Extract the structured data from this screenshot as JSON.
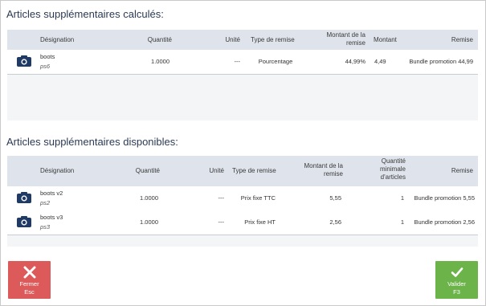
{
  "calc": {
    "title": "Articles supplémentaires calculés:",
    "headers": {
      "designation": "Désignation",
      "quantite": "Quantité",
      "unite": "Unité",
      "type": "Type de remise",
      "montant_remise_1": "Montant de la",
      "montant_remise_2": "remise",
      "montant": "Montant",
      "remise": "Remise"
    },
    "rows": [
      {
        "icon": "camera-icon",
        "name": "boots",
        "code": "ps6",
        "quantite": "1.0000",
        "unite": "---",
        "type": "Pourcentage",
        "montant_remise": "44,99%",
        "montant": "4,49",
        "remise": "Bundle promotion 44,99"
      }
    ]
  },
  "avail": {
    "title": "Articles supplémentaires disponibles:",
    "headers": {
      "designation": "Désignation",
      "quantite": "Quantité",
      "unite": "Unité",
      "type": "Type de remise",
      "montant_remise_1": "Montant de la",
      "montant_remise_2": "remise",
      "qte_min_1": "Quantité",
      "qte_min_2": "minimale",
      "qte_min_3": "d'articles",
      "remise": "Remise"
    },
    "rows": [
      {
        "icon": "camera-icon",
        "name": "boots v2",
        "code": "ps2",
        "quantite": "1.0000",
        "unite": "---",
        "type": "Prix fixe TTC",
        "montant_remise": "5,55",
        "qte_min": "1",
        "remise": "Bundle promotion 5,55"
      },
      {
        "icon": "camera-icon",
        "name": "boots v3",
        "code": "ps3",
        "quantite": "1.0000",
        "unite": "---",
        "type": "Prix fixe HT",
        "montant_remise": "2,56",
        "qte_min": "1",
        "remise": "Bundle promotion 2,56"
      }
    ]
  },
  "buttons": {
    "close": {
      "label": "Fermer",
      "key": "Esc",
      "color": "#dc5a5a"
    },
    "validate": {
      "label": "Valider",
      "key": "F3",
      "color": "#6cb34a"
    }
  }
}
